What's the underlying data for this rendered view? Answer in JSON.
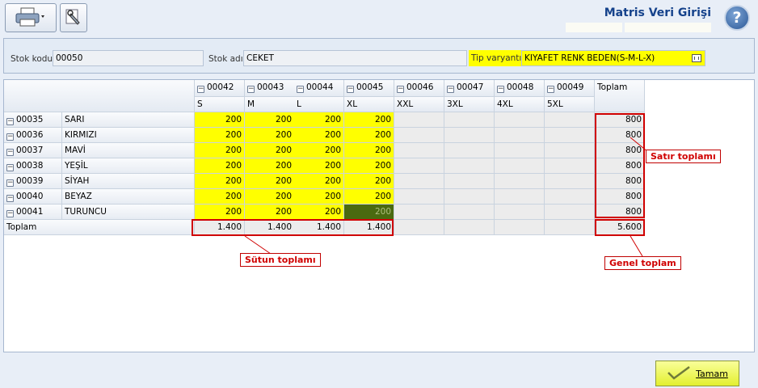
{
  "header": {
    "title": "Matris Veri Girişi",
    "help_label": "?"
  },
  "toolbar": {
    "print_icon": "printer-icon",
    "settings_icon": "wrench-icon"
  },
  "info": {
    "stok_kodu_label": "Stok kodu",
    "stok_kodu_value": "00050",
    "stok_adi_label": "Stok adı",
    "stok_adi_value": "CEKET",
    "tip_varyanti_label": "Tip varyantı",
    "tip_varyanti_value": "KIYAFET RENK BEDEN(S-M-L-X)"
  },
  "grid": {
    "columns": [
      {
        "code": "00042",
        "size": "S"
      },
      {
        "code": "00043",
        "size": "M"
      },
      {
        "code": "00044",
        "size": "L"
      },
      {
        "code": "00045",
        "size": "XL"
      },
      {
        "code": "00046",
        "size": "XXL"
      },
      {
        "code": "00047",
        "size": "3XL"
      },
      {
        "code": "00048",
        "size": "4XL"
      },
      {
        "code": "00049",
        "size": "5XL"
      }
    ],
    "total_header": "Toplam",
    "rows": [
      {
        "code": "00035",
        "name": "SARI",
        "values": [
          "200",
          "200",
          "200",
          "200",
          "",
          "",
          "",
          ""
        ],
        "total": "800"
      },
      {
        "code": "00036",
        "name": "KIRMIZI",
        "values": [
          "200",
          "200",
          "200",
          "200",
          "",
          "",
          "",
          ""
        ],
        "total": "800"
      },
      {
        "code": "00037",
        "name": "MAVİ",
        "values": [
          "200",
          "200",
          "200",
          "200",
          "",
          "",
          "",
          ""
        ],
        "total": "800"
      },
      {
        "code": "00038",
        "name": "YEŞİL",
        "values": [
          "200",
          "200",
          "200",
          "200",
          "",
          "",
          "",
          ""
        ],
        "total": "800"
      },
      {
        "code": "00039",
        "name": "SİYAH",
        "values": [
          "200",
          "200",
          "200",
          "200",
          "",
          "",
          "",
          ""
        ],
        "total": "800"
      },
      {
        "code": "00040",
        "name": "BEYAZ",
        "values": [
          "200",
          "200",
          "200",
          "200",
          "",
          "",
          "",
          ""
        ],
        "total": "800"
      },
      {
        "code": "00041",
        "name": "TURUNCU",
        "values": [
          "200",
          "200",
          "200",
          "200",
          "",
          "",
          "",
          ""
        ],
        "total": "800"
      }
    ],
    "footer_label": "Toplam",
    "footer_values": [
      "1.400",
      "1.400",
      "1.400",
      "1.400",
      "",
      "",
      "",
      ""
    ],
    "grand_total": "5.600"
  },
  "annotations": {
    "row_total": "Satır toplamı",
    "column_total": "Sütun toplamı",
    "grand_total": "Genel toplam"
  },
  "footer": {
    "ok_label": "Tamam"
  },
  "colors": {
    "highlight": "#ffff00",
    "annotation": "#d00000",
    "accent": "#15428b"
  }
}
